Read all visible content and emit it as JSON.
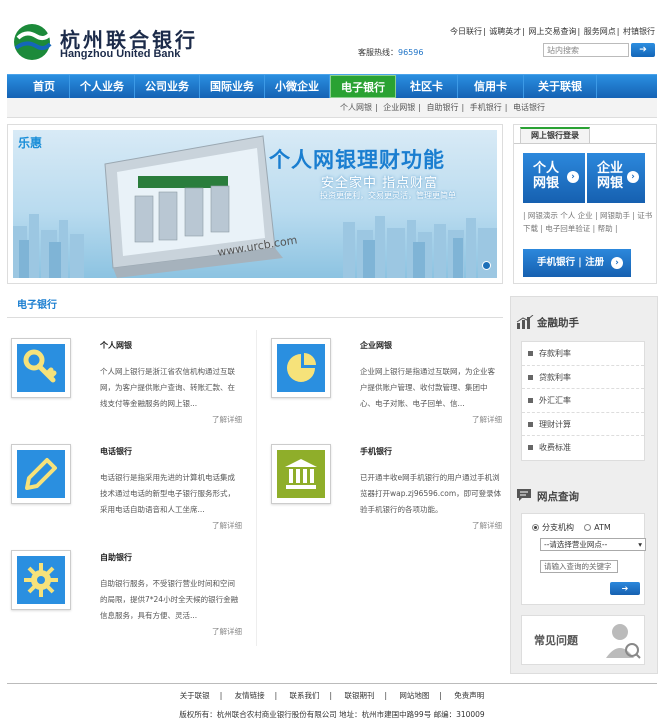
{
  "header": {
    "logo_cn": "杭州联合银行",
    "logo_en": "Hangzhou United Bank",
    "top_links": [
      "今日联行",
      "诚聘英才",
      "网上交易查询",
      "服务网点",
      "村镇银行"
    ],
    "hotline_label": "客服热线：",
    "hotline_number": "96596",
    "search_placeholder": "站内搜索"
  },
  "nav": {
    "items": [
      "首页",
      "个人业务",
      "公司业务",
      "国际业务",
      "小微企业",
      "电子银行",
      "社区卡",
      "信用卡",
      "关于联银"
    ],
    "active": "电子银行"
  },
  "subnav": {
    "items": [
      "个人网银",
      "企业网银",
      "自助银行",
      "手机银行",
      "电话银行"
    ]
  },
  "banner": {
    "badge": "乐惠",
    "title": "个人网银理财功能",
    "subtitle": "安全家中  指点财富",
    "subtitle2": "投资更便利，交易更灵活，管理更简单",
    "url": "www.urcb.com"
  },
  "login": {
    "tab": "网上银行登录",
    "personal": [
      "个人",
      "网银"
    ],
    "enterprise": [
      "企业",
      "网银"
    ],
    "links": "| 网银演示  个人  企业 | 网银助手 | 证书下载 | 电子回单验证 | 帮助 |",
    "mobile": "手机银行 | 注册"
  },
  "section": {
    "title": "电子银行",
    "more": "了解详细"
  },
  "items": [
    {
      "title": "个人网银",
      "text": "个人网上银行是浙江省农信机构通过互联网，为客户提供账户查询、转账汇款、在线支付等金融服务的网上银..."
    },
    {
      "title": "企业网银",
      "text": "企业网上银行是指通过互联网，为企业客户提供账户管理、收付款管理、集团中心、电子对账、电子回单、信..."
    },
    {
      "title": "电话银行",
      "text": "电话银行是指采用先进的计算机电话集成技术通过电话的新型电子银行服务形式，采用电话自助语音和人工坐席..."
    },
    {
      "title": "手机银行",
      "text": "已开通丰收e网手机银行的用户通过手机浏览器打开wap.zj96596.com，即可登录体验手机银行的各项功能。"
    },
    {
      "title": "自助银行",
      "text": "自助银行服务，不受银行营业时间和空间的局限，提供7*24小时全天候的银行金融信息服务，具有方便、灵活..."
    }
  ],
  "sidebar": {
    "finance_title": "金融助手",
    "finance_items": [
      "存款利率",
      "贷款利率",
      "外汇汇率",
      "理财计算",
      "收费标准"
    ],
    "branch_title": "网点查询",
    "radio_branch": "分支机构",
    "radio_atm": "ATM",
    "select_default": "--请选择营业网点--",
    "keyword_placeholder": "请输入查询的关键字",
    "faq": "常见问题"
  },
  "footer": {
    "links": [
      "关于联银",
      "友情链接",
      "联系我们",
      "联银期刊",
      "网站地图",
      "免责声明"
    ],
    "info": "版权所有：杭州联合农村商业银行股份有限公司    地址：杭州市建国中路99号    邮编：310009"
  },
  "colors": {
    "primary": "#1a6cc0",
    "active": "#2aa233"
  }
}
